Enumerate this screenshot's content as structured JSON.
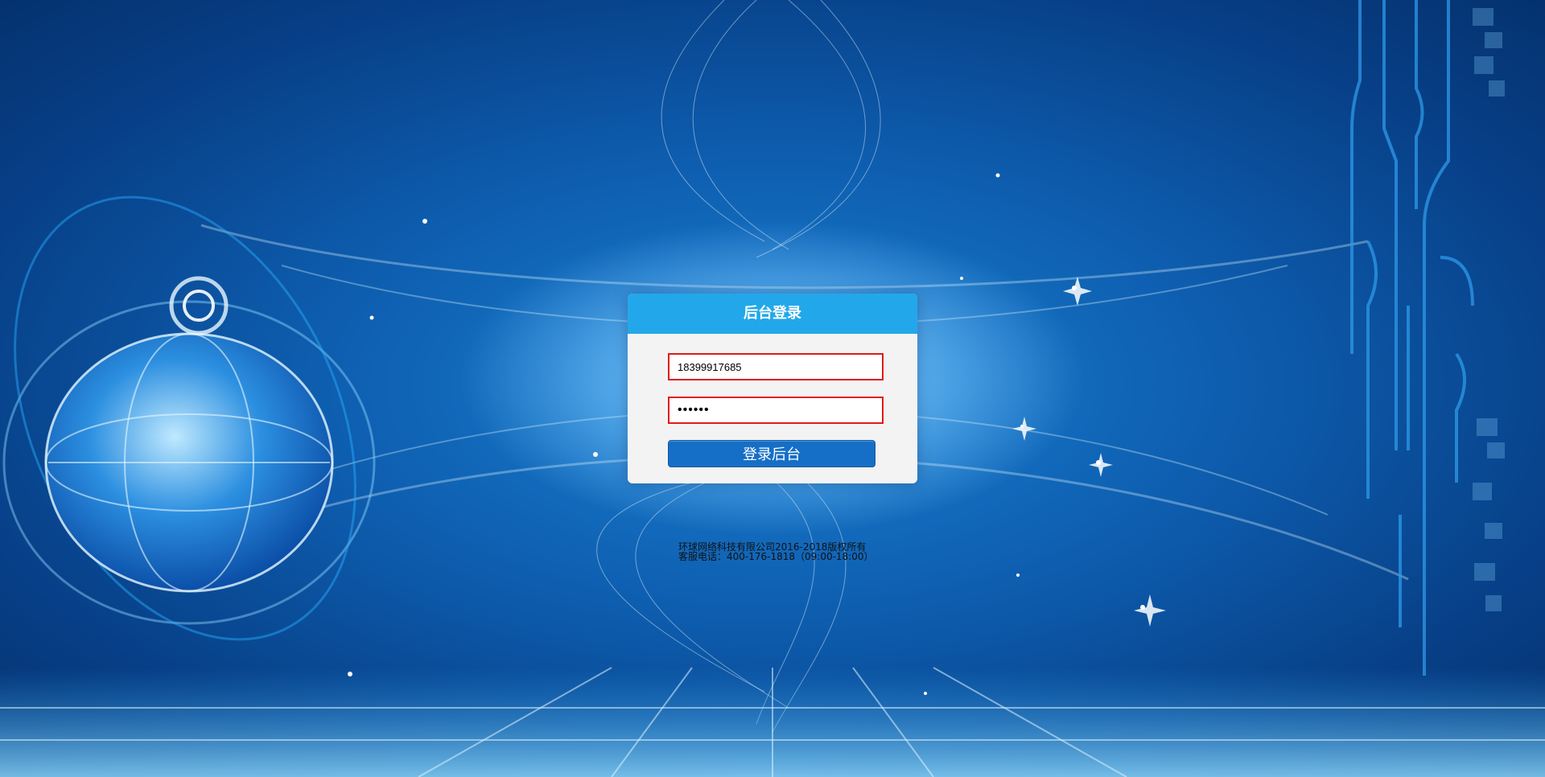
{
  "login": {
    "title": "后台登录",
    "username_value": "18399917685",
    "password_value": "••••••",
    "submit_label": "登录后台"
  },
  "footer": {
    "copyright": "环球网络科技有限公司2016-2018版权所有",
    "hotline": "客服电话：400-176-1818（09:00-18:00）"
  },
  "colors": {
    "header": "#22a8ea",
    "button": "#166fc6",
    "field_border": "#e01a1a",
    "panel": "#f4f3f3"
  },
  "icons": [
    "globe-illustration",
    "circuit-lines-decoration"
  ]
}
